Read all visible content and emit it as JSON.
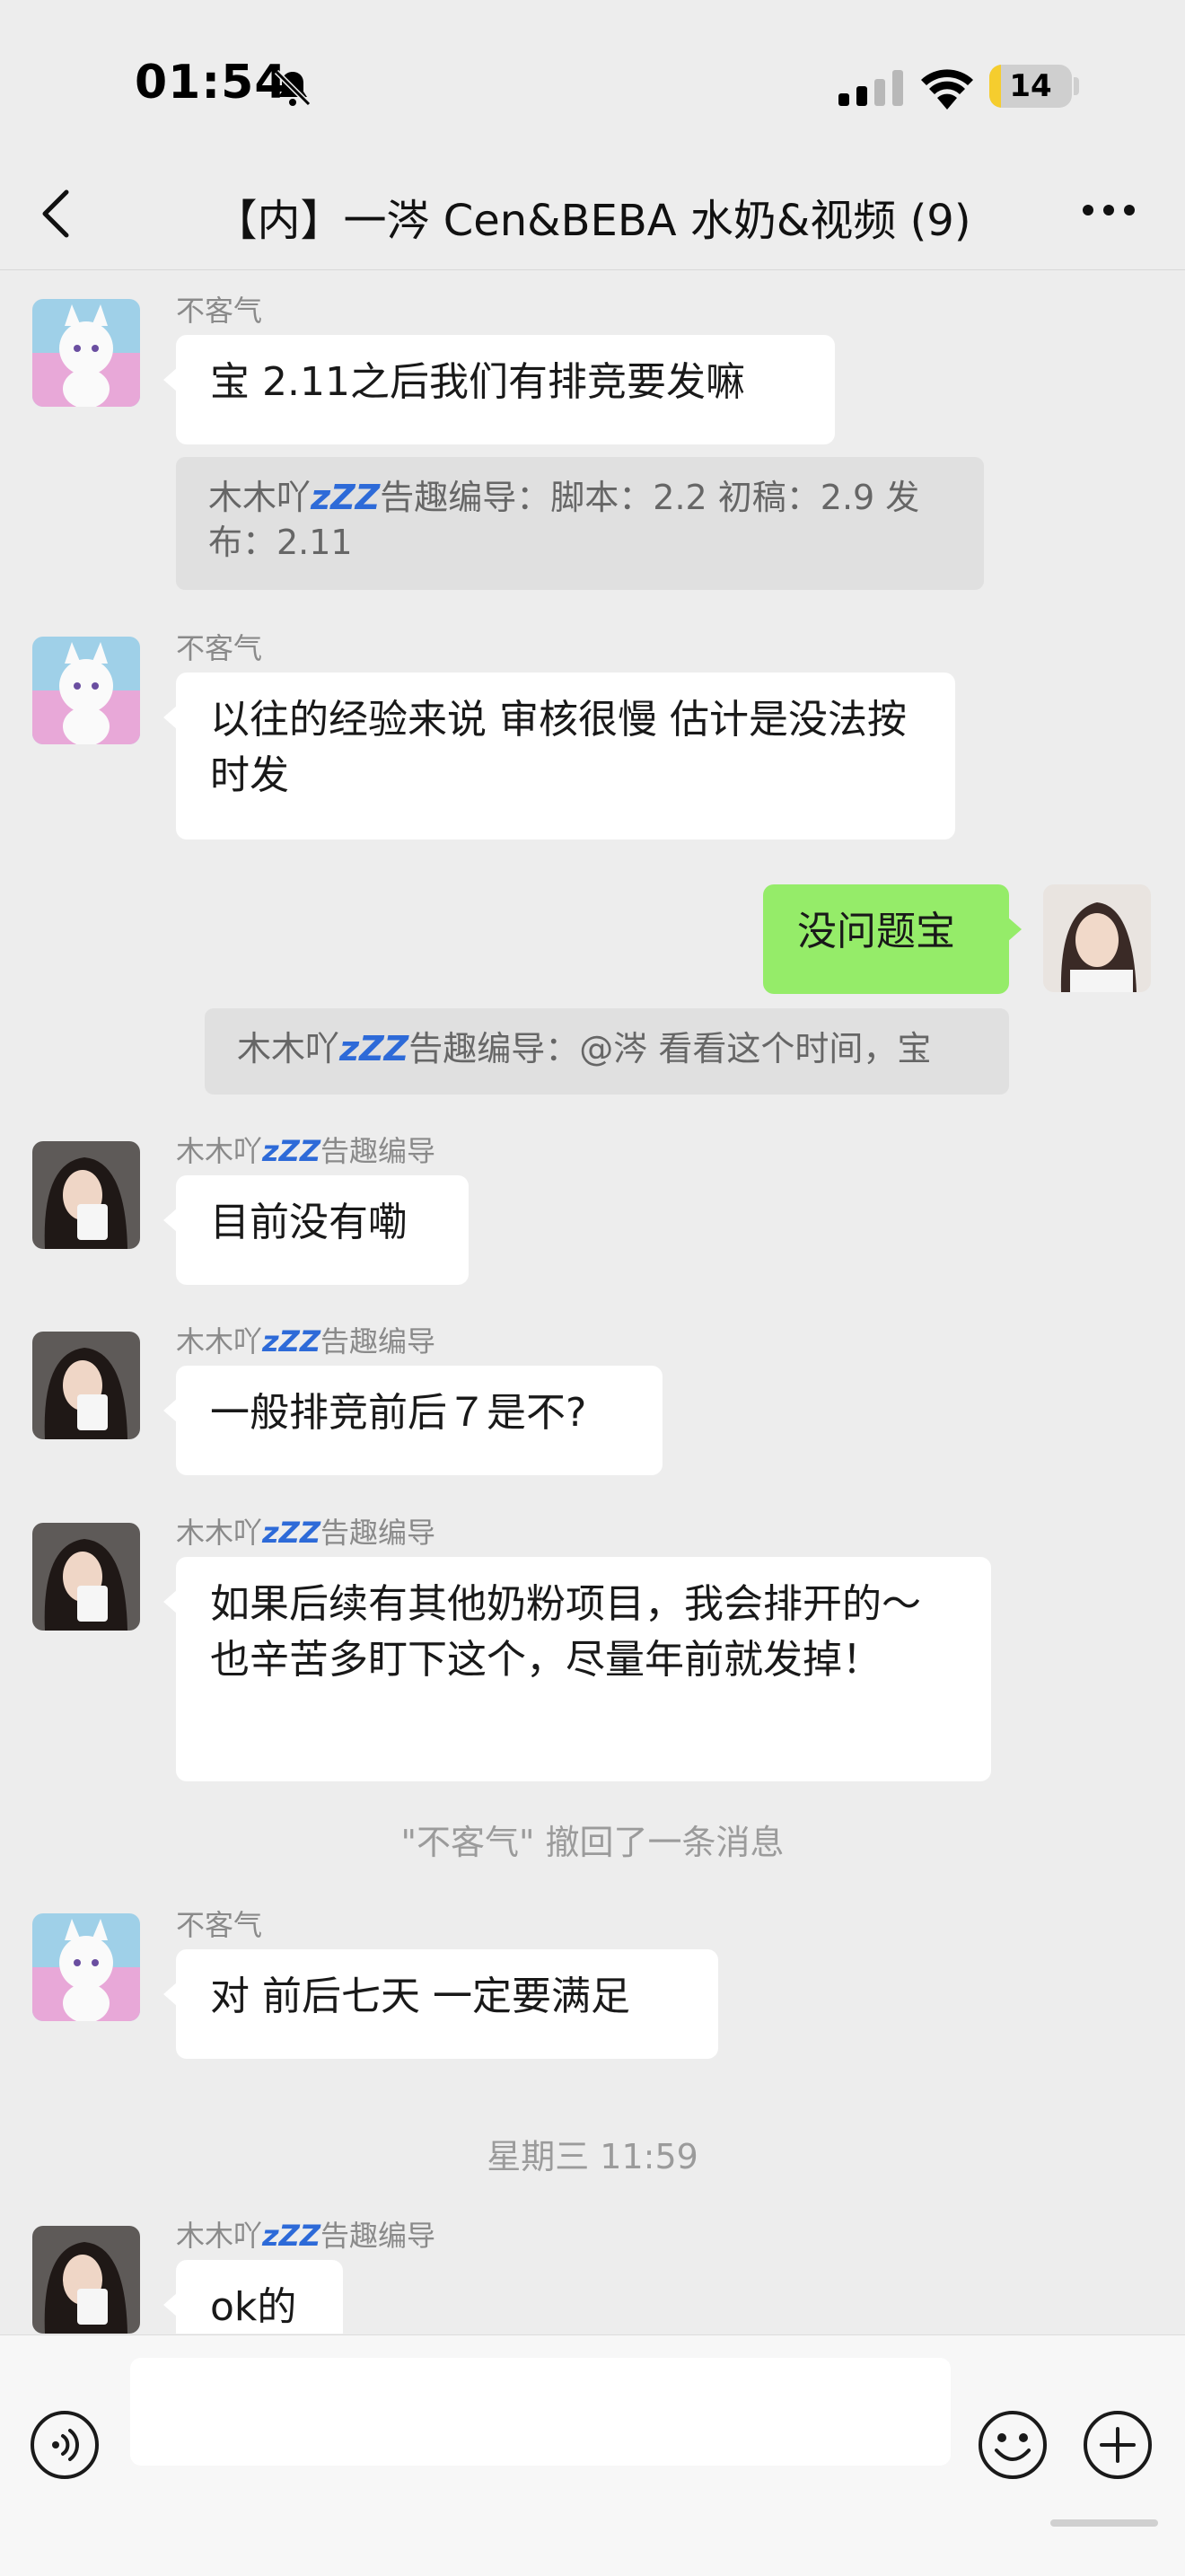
{
  "status_bar": {
    "time": "01:54",
    "battery": "14",
    "battery_level": 0.14
  },
  "header": {
    "title": "【内】一涔 Cen&BEBA 水奶&视频 (9)"
  },
  "messages": [
    {
      "sender": "不客气",
      "text": "宝 2.11之后我们有排竞要发嘛"
    },
    {
      "quote": {
        "name": "木木吖",
        "zzz": "zZZ",
        "tag": "告趣编导",
        "text": "：脚本：2.2 初稿：2.9 发布：2.11"
      }
    },
    {
      "sender": "不客气",
      "text": "以往的经验来说  审核很慢 估计是没法按时发"
    },
    {
      "text": "没问题宝"
    },
    {
      "quote": {
        "name": "木木吖",
        "zzz": "zZZ",
        "tag": "告趣编导",
        "text": "：@涔 看看这个时间，宝"
      }
    },
    {
      "sender": {
        "name": "木木吖",
        "zzz": "zZZ",
        "tag": "告趣编导"
      },
      "text": "目前没有嘞"
    },
    {
      "sender": {
        "name": "木木吖",
        "zzz": "zZZ",
        "tag": "告趣编导"
      },
      "text": "一般排竞前后７是不?"
    },
    {
      "sender": {
        "name": "木木吖",
        "zzz": "zZZ",
        "tag": "告趣编导"
      },
      "text_line1": "如果后续有其他奶粉项目，我会排开的～",
      "text_line2": "也辛苦多盯下这个，尽量年前就发掉！"
    },
    {
      "system": "\"不客气\" 撤回了一条消息"
    },
    {
      "sender": "不客气",
      "text": "对 前后七天 一定要满足"
    },
    {
      "timestamp": "星期三 11:59"
    },
    {
      "sender": {
        "name": "木木吖",
        "zzz": "zZZ",
        "tag": "告趣编导"
      },
      "text": "ok的"
    }
  ],
  "icons": {
    "back": "chevron-left",
    "more": "ellipsis",
    "voice": "voice-wave",
    "emoji": "smiley",
    "plus": "plus-circle",
    "bell": "bell-slash",
    "signal": "cellular-signal",
    "wifi": "wifi"
  },
  "colors": {
    "background": "#ededed",
    "own_bubble": "#95ec69",
    "other_bubble": "#ffffff",
    "battery": "#f5cd2e"
  }
}
